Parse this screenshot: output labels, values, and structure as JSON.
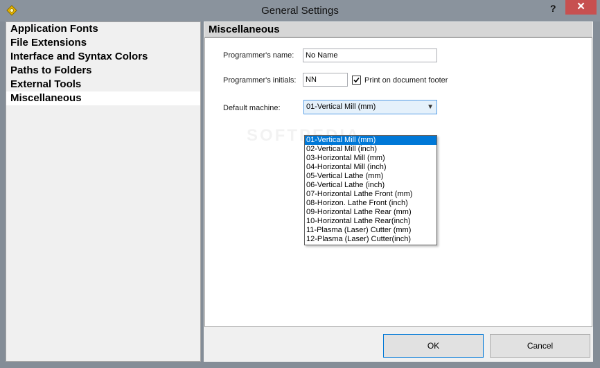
{
  "window": {
    "title": "General Settings",
    "help_label": "?",
    "close_label": "✕",
    "app_icon": "gear-diamond-icon"
  },
  "sidebar": {
    "items": [
      {
        "label": "Application Fonts"
      },
      {
        "label": "File Extensions"
      },
      {
        "label": "Interface and Syntax Colors"
      },
      {
        "label": "Paths to Folders"
      },
      {
        "label": "External Tools"
      },
      {
        "label": "Miscellaneous"
      }
    ],
    "selected_index": 5
  },
  "panel": {
    "title": "Miscellaneous",
    "programmer_name_label": "Programmer's name:",
    "programmer_name_value": "No Name",
    "programmer_initials_label": "Programmer's initials:",
    "programmer_initials_value": "NN",
    "print_footer_label": "Print on document footer",
    "print_footer_checked": true,
    "default_machine_label": "Default machine:",
    "default_machine_value": "01-Vertical Mill (mm)",
    "watermark": "SOFTPEDIA",
    "machine_options": [
      "01-Vertical Mill (mm)",
      "02-Vertical Mill (inch)",
      "03-Horizontal Mill (mm)",
      "04-Horizontal Mill (inch)",
      "05-Vertical Lathe (mm)",
      "06-Vertical Lathe (inch)",
      "07-Horizontal Lathe Front (mm)",
      "08-Horizon. Lathe Front (inch)",
      "09-Horizontal Lathe Rear (mm)",
      "10-Horizontal Lathe Rear(inch)",
      "11-Plasma (Laser) Cutter (mm)",
      "12-Plasma (Laser) Cutter(inch)"
    ],
    "selected_option_index": 0
  },
  "buttons": {
    "ok": "OK",
    "cancel": "Cancel"
  },
  "colors": {
    "titlebar": "#8a939d",
    "close": "#c75050",
    "selection": "#0078d7"
  }
}
